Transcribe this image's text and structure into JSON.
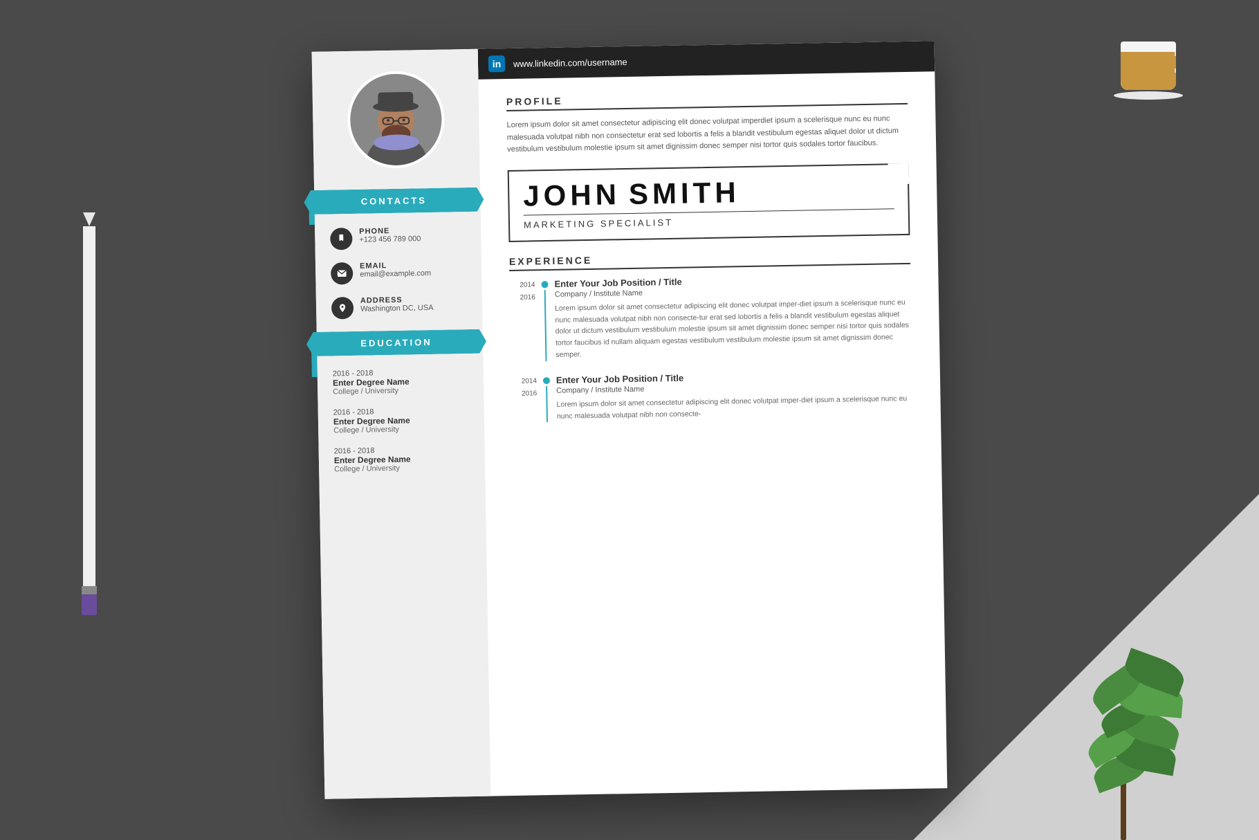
{
  "background": {
    "color": "#4a4a4a"
  },
  "linkedin": {
    "url": "www.linkedin.com/username",
    "logo": "in"
  },
  "profile": {
    "section_title": "PROFILE",
    "text": "Lorem ipsum dolor sit amet consectetur adipiscing elit donec volutpat imperdiet ipsum a scelerisque nunc eu nunc malesuada volutpat nibh non consectetur erat sed lobortis a felis a blandit vestibulum egestas aliquet dolor ut dictum vestibulum vestibulum molestie ipsum sit amet dignissim donec semper nisi tortor quis sodales tortor faucibus."
  },
  "name": {
    "full": "JOHN  SMITH",
    "first": "JOHN",
    "last": "SMITH",
    "job_title": "MARKETING SPECIALIST"
  },
  "contacts": {
    "section_title": "CONTACTS",
    "phone": {
      "label": "PHONE",
      "value": "+123 456 789 000",
      "icon": "📱"
    },
    "email": {
      "label": "EMAIL",
      "value": "email@example.com",
      "icon": "✉"
    },
    "address": {
      "label": "ADDRESS",
      "value": "Washington DC, USA",
      "icon": "🏠"
    }
  },
  "education": {
    "section_title": "EDUCATION",
    "items": [
      {
        "years": "2016 - 2018",
        "degree": "Enter Degree Name",
        "school": "College / University"
      },
      {
        "years": "2016 - 2018",
        "degree": "Enter Degree Name",
        "school": "College / University"
      },
      {
        "years": "2016 - 2018",
        "degree": "Enter Degree Name",
        "school": "College / University"
      }
    ]
  },
  "experience": {
    "section_title": "EXPERIENCE",
    "items": [
      {
        "year_start": "2014",
        "year_end": "2016",
        "position": "Enter Your Job Position / Title",
        "company": "Company / Institute Name",
        "description": "Lorem ipsum dolor sit amet consectetur adipiscing elit donec volutpat imper-diet ipsum a scelerisque nunc eu nunc malesuada volutpat nibh non consecte-tur erat sed lobortis a felis a blandit vestibulum egestas aliquet dolor ut dictum vestibulum vestibulum molestie ipsum sit amet dignissim donec semper nisi tortor quis sodales tortor faucibus id nullam aliquam egestas vestibulum vestibulum molestie ipsum sit amet dignissim donec semper."
      },
      {
        "year_start": "2014",
        "year_end": "2016",
        "position": "Enter Your Job Position / Title",
        "company": "Company / Institute Name",
        "description": "Lorem ipsum dolor sit amet consectetur adipiscing elit donec volutpat imper-diet ipsum a scelerisque nunc eu nunc malesuada volutpat nibh non consecte-"
      }
    ]
  }
}
